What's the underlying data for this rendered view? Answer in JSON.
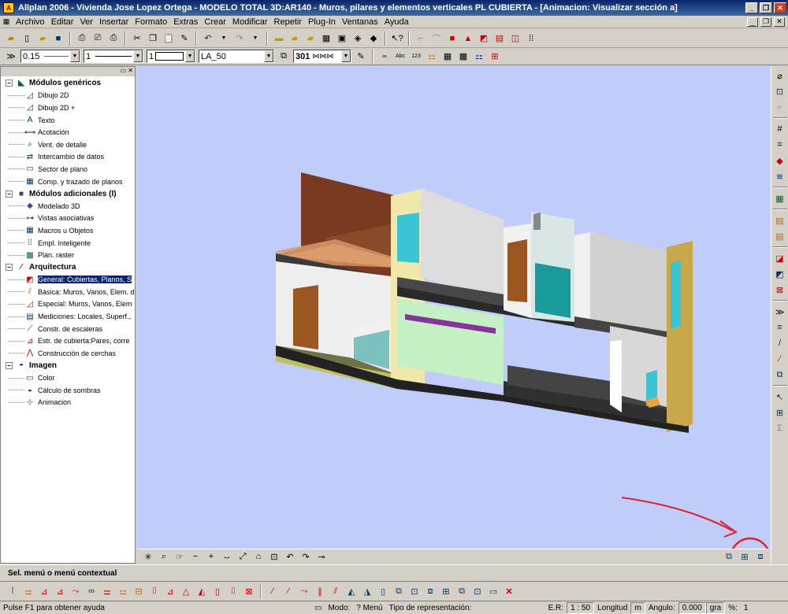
{
  "window": {
    "title": "Allplan 2006 - Vivienda Jose Lopez Ortega - MODELO TOTAL 3D:AR140 - Muros, pilares y elementos verticales PL CUBIERTA - [Animacion: Visualizar sección a]",
    "controls": [
      "_",
      "❐",
      "✕"
    ]
  },
  "menu": {
    "items": [
      "Archivo",
      "Editar",
      "Ver",
      "Insertar",
      "Formato",
      "Extras",
      "Crear",
      "Modificar",
      "Repetir",
      "Plug-In",
      "Ventanas",
      "Ayuda"
    ],
    "mdi_controls": [
      "_",
      "❐",
      "✕"
    ]
  },
  "format_bar": {
    "pen": "0.15",
    "line": "1",
    "pattern": "1",
    "layer": "LA_50",
    "hatch": "301"
  },
  "tree": [
    {
      "label": "Módulos genéricos",
      "group": true,
      "icon": "generic-modules-icon"
    },
    {
      "label": "Dibujo 2D",
      "icon": "draw2d-icon"
    },
    {
      "label": "Dibujo 2D +",
      "icon": "draw2d-plus-icon"
    },
    {
      "label": "Texto",
      "icon": "text-icon"
    },
    {
      "label": "Acotación",
      "icon": "dimension-icon"
    },
    {
      "label": "Vent. de detalle",
      "icon": "detail-window-icon"
    },
    {
      "label": "Intercambio de datos",
      "icon": "data-exchange-icon"
    },
    {
      "label": "Sector de plano",
      "icon": "plan-sector-icon"
    },
    {
      "label": "Comp. y trazado de planos",
      "icon": "plot-layout-icon"
    },
    {
      "label": "Módulos adicionales (I)",
      "group": true,
      "icon": "additional-modules-icon"
    },
    {
      "label": "Modelado 3D",
      "icon": "model3d-icon"
    },
    {
      "label": "Vistas asociativas",
      "icon": "associative-views-icon"
    },
    {
      "label": "Macros u Objetos",
      "icon": "macros-icon"
    },
    {
      "label": "Empl. Inteligente",
      "icon": "smart-placement-icon"
    },
    {
      "label": "Plan. raster",
      "icon": "raster-icon"
    },
    {
      "label": "Arquitectura",
      "group": true,
      "icon": "architecture-icon"
    },
    {
      "label": "General: Cubiertas, Planos, S",
      "icon": "general-roofs-icon",
      "active": true
    },
    {
      "label": "Básica: Muros, Vanos, Elem. d",
      "icon": "basic-walls-icon"
    },
    {
      "label": "Especial: Muros, Vanos, Elem",
      "icon": "special-walls-icon"
    },
    {
      "label": "Mediciones: Locales, Superf., ",
      "icon": "quantities-icon"
    },
    {
      "label": "Constr. de escaleras",
      "icon": "stairs-icon"
    },
    {
      "label": "Estr. de cubierta:Pares, corre",
      "icon": "roof-structure-icon"
    },
    {
      "label": "Construcción de cerchas",
      "icon": "trusses-icon"
    },
    {
      "label": "Imagen",
      "group": true,
      "icon": "image-icon"
    },
    {
      "label": "Color",
      "icon": "color-icon"
    },
    {
      "label": "Cálculo de sombras",
      "icon": "shadows-icon"
    },
    {
      "label": "Animacion",
      "icon": "animation-icon"
    }
  ],
  "prompt": "Sel. menú o menú contextual",
  "status": {
    "help": "Pulse F1 para obtener ayuda",
    "mode_label": "Modo:",
    "mode_value": "? Menú",
    "repr_label": "Tipo de representación:",
    "scale_label": "E.R:",
    "scale_value": "1 : 50",
    "length_label": "Longitud",
    "length_unit": "m",
    "angle_label": "Angulo:",
    "angle_value": "0.000",
    "angle_unit": "gra",
    "percent_label": "%:",
    "percent_value": "1"
  },
  "colors": {
    "titlebar": "#0a246a",
    "viewport": "#c0cdfb",
    "annotation": "#e0202a"
  }
}
